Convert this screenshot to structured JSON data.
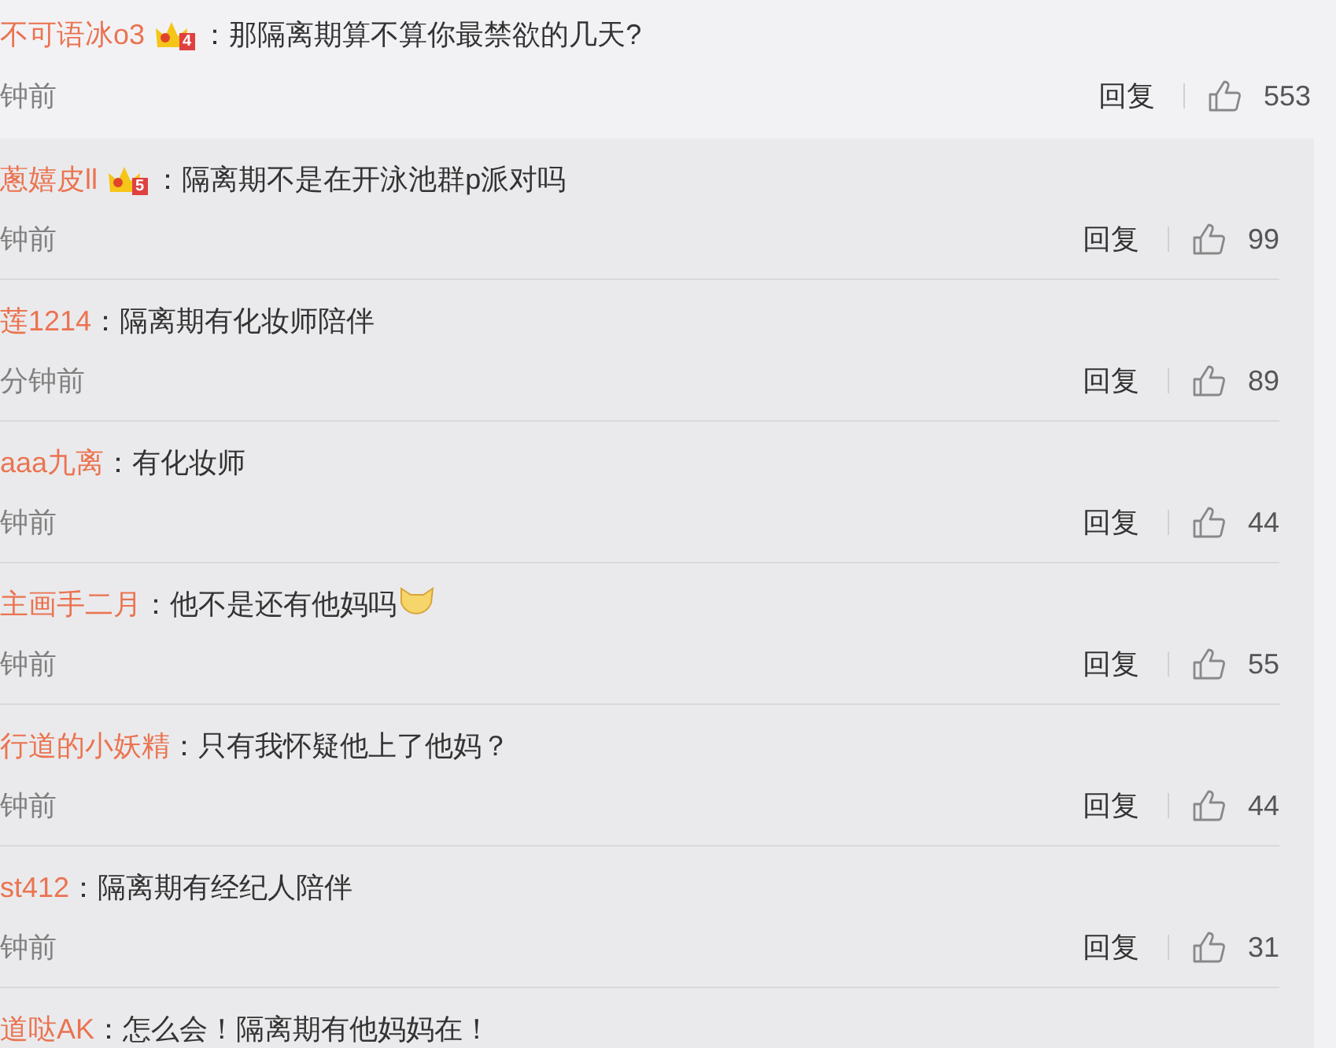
{
  "main_comment": {
    "username": "不可语冰o3",
    "badge": "4",
    "text": "：那隔离期算不算你最禁欲的几天?",
    "time": "钟前",
    "reply": "回复",
    "likes": "553"
  },
  "replies": [
    {
      "username": "蔥嬉皮ll",
      "badge": "5",
      "text": "：隔离期不是在开泳池群p派对吗",
      "emoji": false,
      "time": "钟前",
      "reply": "回复",
      "likes": "99"
    },
    {
      "username": "莲1214",
      "text": "：隔离期有化妆师陪伴",
      "emoji": false,
      "time": "分钟前",
      "reply": "回复",
      "likes": "89"
    },
    {
      "username": "aaa九离",
      "text": "：有化妆师",
      "emoji": false,
      "time": "钟前",
      "reply": "回复",
      "likes": "44"
    },
    {
      "username": "主画手二月",
      "text": "：他不是还有他妈吗",
      "emoji": true,
      "time": "钟前",
      "reply": "回复",
      "likes": "55"
    },
    {
      "username": "行道的小妖精",
      "text": "：只有我怀疑他上了他妈？",
      "emoji": false,
      "time": "钟前",
      "reply": "回复",
      "likes": "44"
    },
    {
      "username": "st412",
      "text": "：隔离期有经纪人陪伴",
      "emoji": false,
      "time": "钟前",
      "reply": "回复",
      "likes": "31"
    },
    {
      "username": "道哒AK",
      "text": "：怎么会！隔离期有他妈妈在！",
      "emoji": false
    }
  ]
}
